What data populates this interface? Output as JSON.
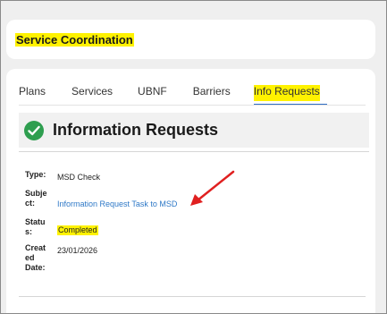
{
  "section": {
    "title": "Service Coordination"
  },
  "tabs": [
    {
      "label": "Plans"
    },
    {
      "label": "Services"
    },
    {
      "label": "UBNF"
    },
    {
      "label": "Barriers"
    },
    {
      "label": "Info Requests",
      "active": true
    }
  ],
  "info_request": {
    "heading": "Information Requests",
    "heading_icon": "check-circle-icon",
    "fields": {
      "type_label": "Type:",
      "type_value": "MSD Check",
      "subject_label": "Subject:",
      "subject_value": "Information Request Task to MSD",
      "status_label": "Status:",
      "status_value": "Completed",
      "created_label": "Created Date:",
      "created_value": "23/01/2026"
    }
  },
  "colors": {
    "highlight": "#fff200",
    "link": "#2f79c7",
    "success": "#2e9e4f",
    "annotation_arrow": "#e02020"
  }
}
